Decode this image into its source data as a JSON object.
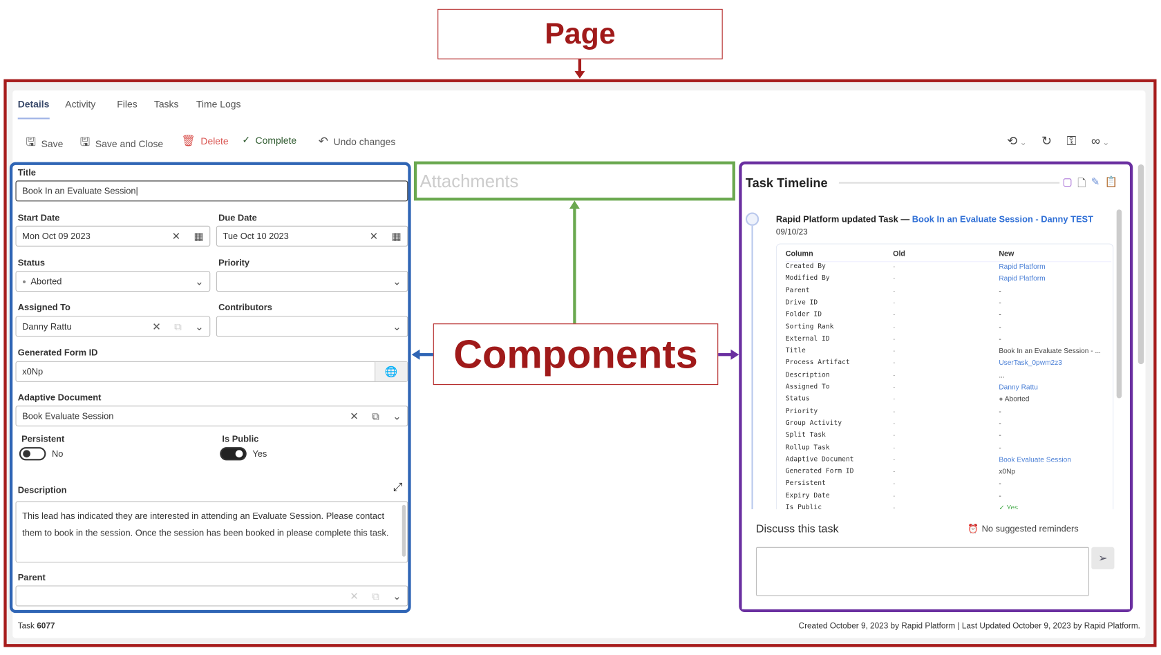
{
  "annotations": {
    "page": "Page",
    "components": "Components",
    "attachments": "Attachments"
  },
  "tabs": [
    {
      "label": "Details",
      "active": true
    },
    {
      "label": "Activity"
    },
    {
      "label": "Files"
    },
    {
      "label": "Tasks"
    },
    {
      "label": "Time Logs"
    }
  ],
  "toolbar": {
    "save": "Save",
    "save_close": "Save and Close",
    "delete": "Delete",
    "complete": "Complete",
    "undo": "Undo changes"
  },
  "form": {
    "title_label": "Title",
    "title_value": "Book In an Evaluate Session",
    "start_label": "Start Date",
    "start_value": "Mon Oct 09 2023",
    "due_label": "Due Date",
    "due_value": "Tue Oct 10 2023",
    "status_label": "Status",
    "status_value": "Aborted",
    "priority_label": "Priority",
    "priority_value": "",
    "assigned_label": "Assigned To",
    "assigned_value": "Danny Rattu",
    "contributors_label": "Contributors",
    "contributors_value": "",
    "formid_label": "Generated Form ID",
    "formid_value": "x0Np",
    "adaptive_label": "Adaptive Document",
    "adaptive_value": "Book Evaluate Session",
    "persistent_label": "Persistent",
    "persistent_value": "No",
    "persistent_on": false,
    "public_label": "Is Public",
    "public_value": "Yes",
    "public_on": true,
    "description_label": "Description",
    "description_value": "This lead has indicated they are interested in attending an Evaluate Session. Please contact them to book in the session. Once the session has been booked in please complete this task.",
    "parent_label": "Parent",
    "parent_value": ""
  },
  "timeline": {
    "title": "Task Timeline",
    "entry_actor": "Rapid Platform updated Task —",
    "entry_link": "Book In an Evaluate Session - Danny TEST",
    "entry_date": "09/10/23",
    "headers": [
      "Column",
      "Old",
      "New"
    ],
    "rows": [
      [
        "Created By",
        "-",
        "Rapid Platform",
        "link"
      ],
      [
        "Modified By",
        "-",
        "Rapid Platform",
        "link"
      ],
      [
        "Parent",
        "-",
        "-",
        ""
      ],
      [
        "Drive ID",
        "-",
        "-",
        ""
      ],
      [
        "Folder ID",
        "-",
        "-",
        ""
      ],
      [
        "Sorting Rank",
        "-",
        "-",
        ""
      ],
      [
        "External ID",
        "-",
        "-",
        ""
      ],
      [
        "Title",
        "-",
        "Book In an Evaluate Session - ...",
        ""
      ],
      [
        "Process Artifact",
        "-",
        "UserTask_0pwm2z3",
        "link"
      ],
      [
        "Description",
        "-",
        "...",
        ""
      ],
      [
        "Assigned To",
        "-",
        "Danny Rattu",
        "link"
      ],
      [
        "Status",
        "-",
        "● Aborted",
        ""
      ],
      [
        "Priority",
        "-",
        "-",
        ""
      ],
      [
        "Group Activity",
        "-",
        "-",
        ""
      ],
      [
        "Split Task",
        "-",
        "-",
        ""
      ],
      [
        "Rollup Task",
        "-",
        "-",
        ""
      ],
      [
        "Adaptive Document",
        "-",
        "Book Evaluate Session",
        "link"
      ],
      [
        "Generated Form ID",
        "-",
        "x0Np",
        ""
      ],
      [
        "Persistent",
        "-",
        "-",
        ""
      ],
      [
        "Expiry Date",
        "-",
        "-",
        ""
      ],
      [
        "Is Public",
        "-",
        "✓ Yes",
        "yes"
      ]
    ],
    "discuss_label": "Discuss this task",
    "reminders": "No suggested reminders",
    "comment_value": ""
  },
  "footer": {
    "task_prefix": "Task",
    "task_number": "6077",
    "meta": "Created October 9, 2023 by Rapid Platform | Last Updated October 9, 2023 by Rapid Platform."
  },
  "colors": {
    "page_frame": "#a61c1c",
    "components_box": "#2f65b5",
    "attachments_box": "#6aa84f",
    "timeline_box": "#6a2fa0",
    "link": "#2f6fd6",
    "delete": "#d9534f"
  }
}
